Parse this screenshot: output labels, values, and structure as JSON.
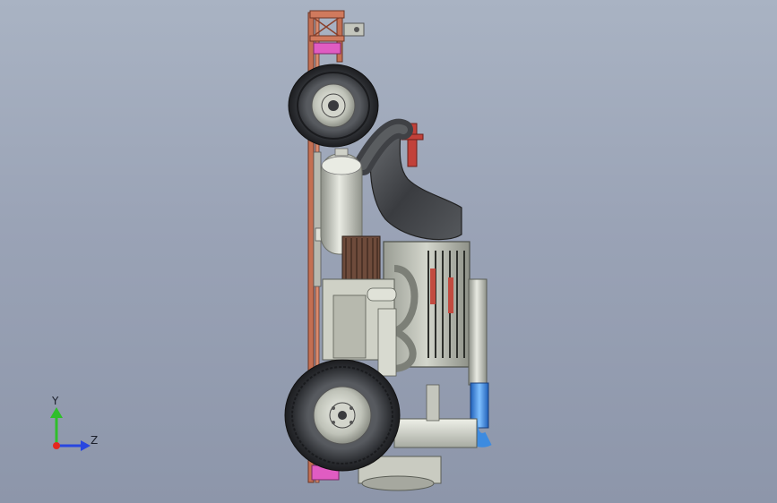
{
  "triad": {
    "x_axis_color": "#e5281f",
    "y_axis_color": "#2fbf2a",
    "z_axis_color": "#2846e0",
    "y_label": "Y",
    "z_label": "Z"
  },
  "model": {
    "frame_color": "#c46f52",
    "accent_color": "#e05cc2",
    "tire_color": "#2a2d33",
    "rim_color": "#b9bcb3",
    "hose_color": "#3f4145",
    "coolant_pipe_color": "#3d8be0",
    "steering_color": "#c2413a"
  }
}
